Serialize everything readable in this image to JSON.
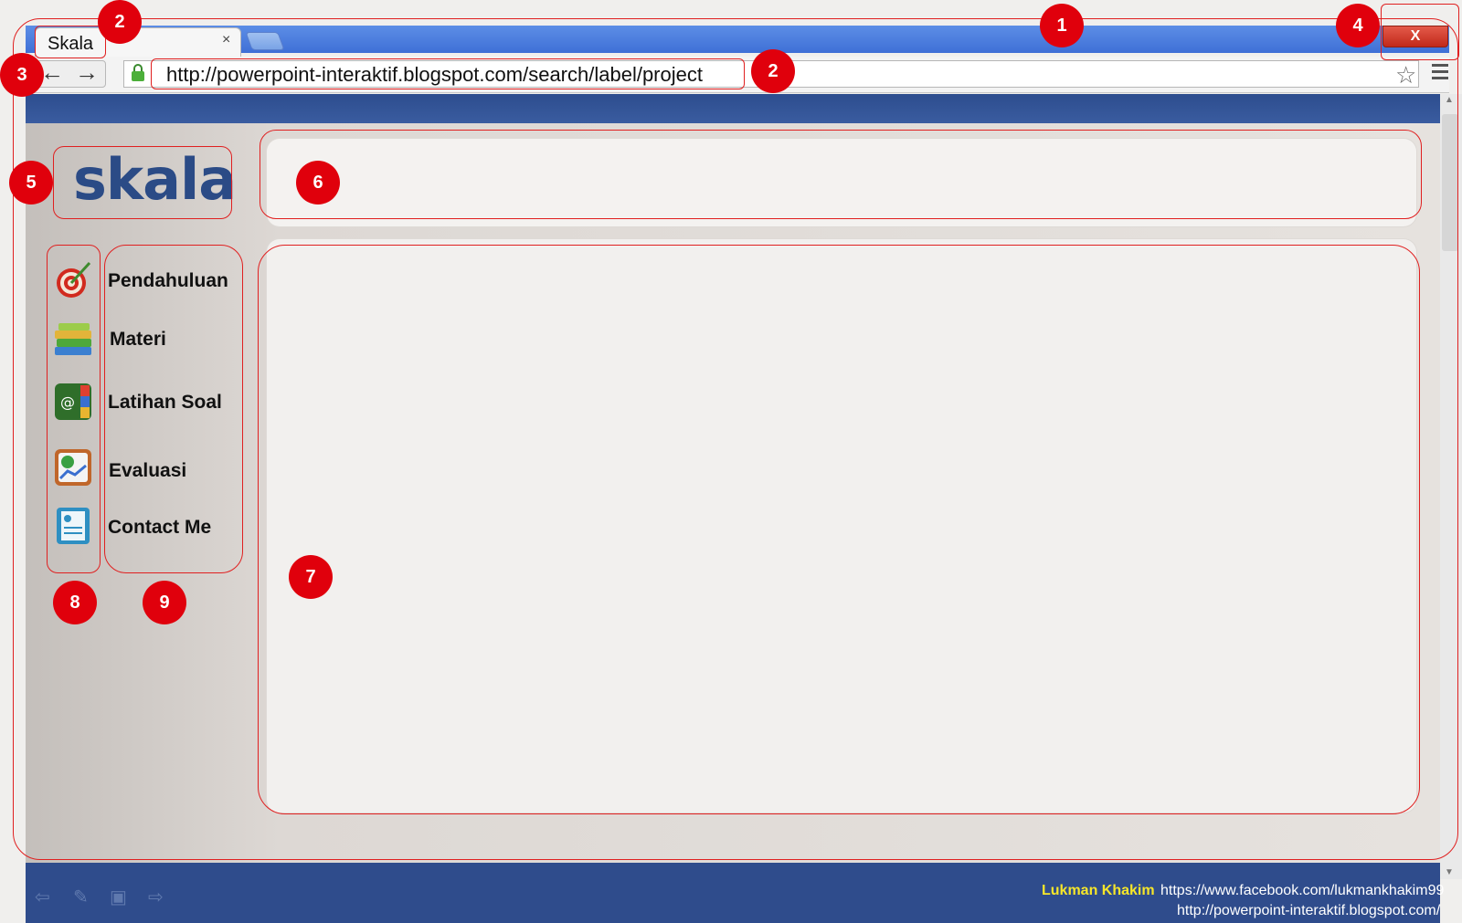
{
  "browser": {
    "tab_title": "Skala",
    "tab_close": "×",
    "close_label": "X",
    "url": "http://powerpoint-interaktif.blogspot.com/search/label/project",
    "back_icon": "arrow-left-icon",
    "forward_icon": "arrow-right-icon",
    "lock_icon": "lock-icon",
    "star_icon": "star-icon",
    "menu_icon": "hamburger-menu-icon"
  },
  "page": {
    "logo_text": "skala",
    "menu": [
      {
        "label": "Pendahuluan",
        "icon": "target-dart-icon"
      },
      {
        "label": "Materi",
        "icon": "books-stack-icon"
      },
      {
        "label": "Latihan Soal",
        "icon": "address-book-icon"
      },
      {
        "label": "Evaluasi",
        "icon": "chart-report-icon"
      },
      {
        "label": "Contact Me",
        "icon": "checklist-document-icon"
      }
    ]
  },
  "annotations": {
    "numbers": [
      "1",
      "2",
      "2",
      "3",
      "4",
      "5",
      "6",
      "7",
      "8",
      "9"
    ]
  },
  "footer": {
    "author": "Lukman Khakim",
    "facebook": "https://www.facebook.com/lukmankhakim99",
    "blog": "http://powerpoint-interaktif.blogspot.com/"
  },
  "colors": {
    "titlebar": "#3f6fd6",
    "page_band": "#2f4c8c",
    "logo": "#2b4b86",
    "annotation": "#e0000c",
    "author": "#f6e62a"
  }
}
